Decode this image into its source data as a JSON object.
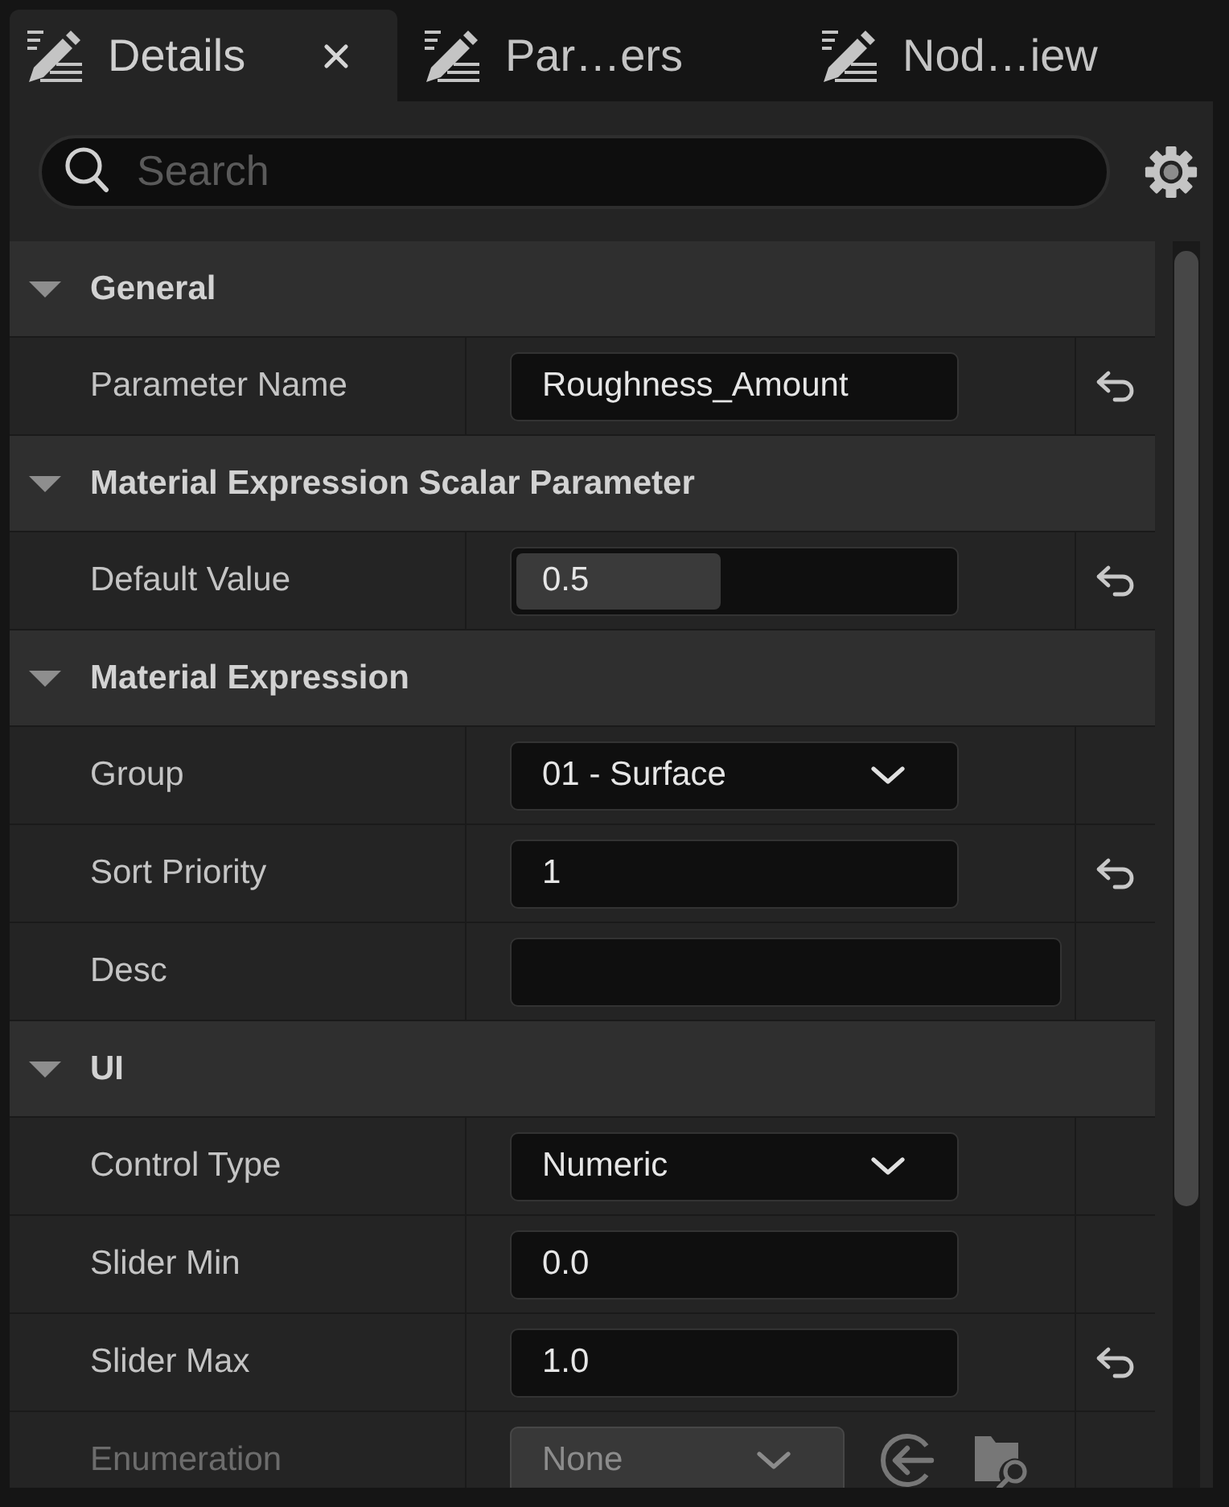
{
  "tabs": [
    {
      "label": "Details",
      "selected": true
    },
    {
      "label": "Par…ers",
      "selected": false
    },
    {
      "label": "Nod…iew",
      "selected": false
    }
  ],
  "search": {
    "placeholder": "Search"
  },
  "categories": [
    {
      "title": "General",
      "expanded": true,
      "properties": [
        {
          "label": "Parameter Name",
          "kind": "text",
          "value": "Roughness_Amount",
          "modified": true,
          "disabled": false
        }
      ]
    },
    {
      "title": "Material Expression Scalar Parameter",
      "expanded": true,
      "properties": [
        {
          "label": "Default Value",
          "kind": "slider",
          "value": "0.5",
          "level": 0.47,
          "modified": true,
          "disabled": false
        }
      ]
    },
    {
      "title": "Material Expression",
      "expanded": true,
      "properties": [
        {
          "label": "Group",
          "kind": "combo",
          "value": "01 - Surface",
          "modified": false,
          "disabled": false
        },
        {
          "label": "Sort Priority",
          "kind": "text",
          "value": "1",
          "modified": true,
          "disabled": false
        },
        {
          "label": "Desc",
          "kind": "multiline",
          "modified": false,
          "disabled": false
        }
      ]
    },
    {
      "title": "UI",
      "expanded": true,
      "properties": [
        {
          "label": "Control Type",
          "kind": "combo",
          "value": "Numeric",
          "modified": false,
          "disabled": false
        },
        {
          "label": "Slider Min",
          "kind": "text",
          "value": "0.0",
          "modified": false,
          "disabled": false
        },
        {
          "label": "Slider Max",
          "kind": "text",
          "value": "1.0",
          "modified": true,
          "disabled": false
        },
        {
          "label": "Enumeration",
          "kind": "asset",
          "value": "None",
          "modified": false,
          "disabled": true
        }
      ]
    }
  ]
}
